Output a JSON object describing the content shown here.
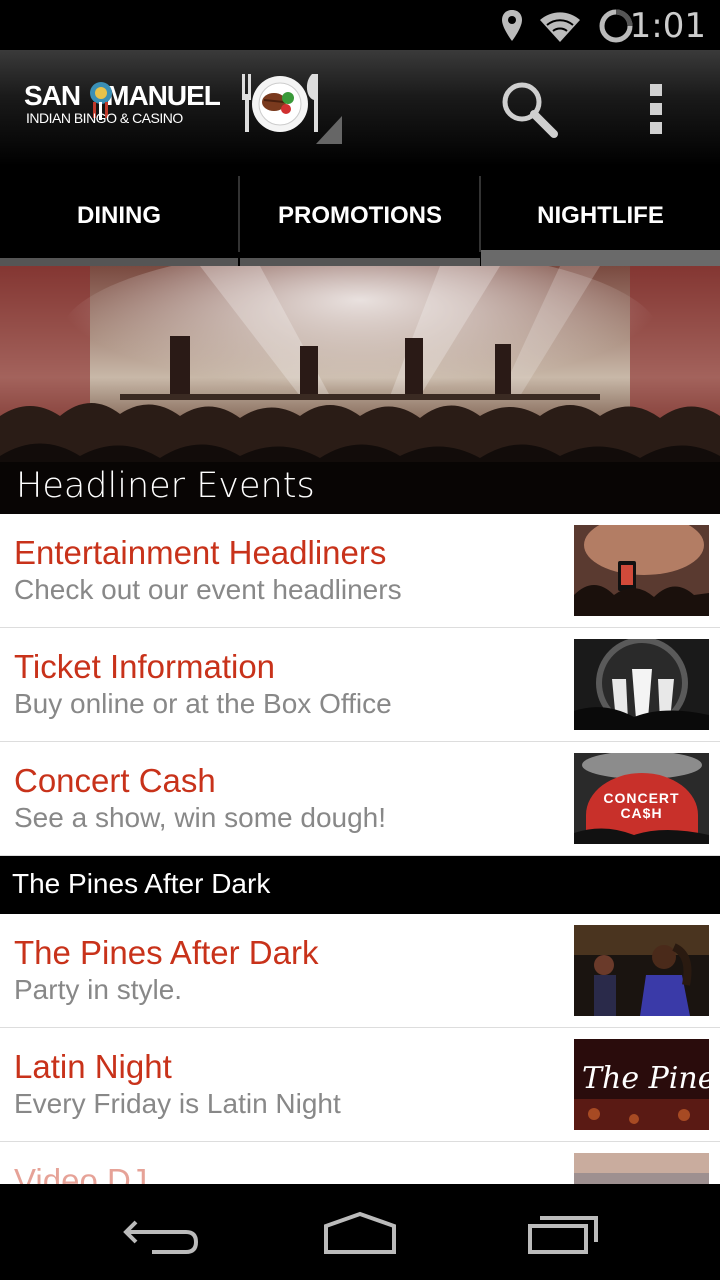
{
  "status_bar": {
    "time": "1:01",
    "icons": [
      "location-icon",
      "wifi-icon",
      "sync-icon"
    ]
  },
  "action_bar": {
    "logo_line1_left": "SAN",
    "logo_line1_right": "MANUEL",
    "logo_line2": "INDIAN  BINGO & CASINO",
    "icons": [
      "dining-plate-icon",
      "search-icon",
      "overflow-menu-icon"
    ]
  },
  "tabs": [
    {
      "label": "DINING",
      "active": false
    },
    {
      "label": "PROMOTIONS",
      "active": false
    },
    {
      "label": "NIGHTLIFE",
      "active": true
    }
  ],
  "hero": {
    "caption": "Headliner Events"
  },
  "items": [
    {
      "title": "Entertainment Headliners",
      "subtitle": "Check out our event headliners"
    },
    {
      "title": "Ticket Information",
      "subtitle": "Buy online or at the Box Office"
    },
    {
      "title": "Concert Cash",
      "subtitle": "See a show, win some dough!"
    }
  ],
  "section": {
    "header": "The Pines After Dark"
  },
  "section_items": [
    {
      "title": "The Pines After Dark",
      "subtitle": "Party in style."
    },
    {
      "title": "Latin Night",
      "subtitle": "Every Friday is Latin Night"
    },
    {
      "title": "Video DJ",
      "subtitle": ""
    }
  ],
  "thumb_text": {
    "concert_cash_line1": "CONCERT",
    "concert_cash_line2": "CA$H",
    "pines_logo": "The Pines"
  },
  "colors": {
    "title_red": "#c8321a",
    "subtitle_gray": "#888888",
    "background": "#000000"
  },
  "nav_bar": {
    "icons": [
      "back-icon",
      "home-icon",
      "recents-icon"
    ]
  }
}
